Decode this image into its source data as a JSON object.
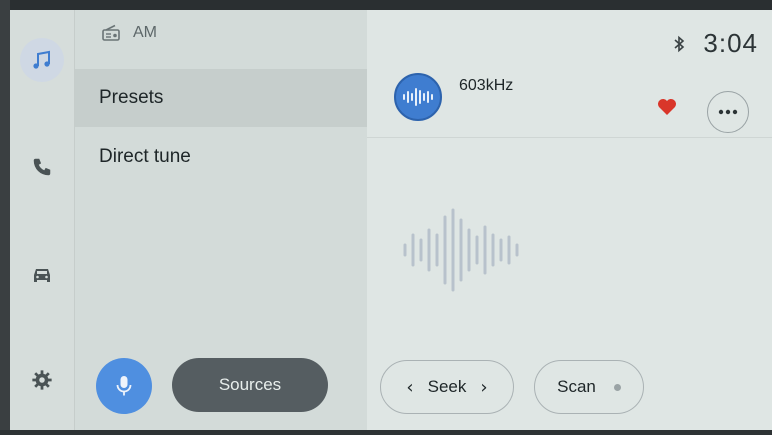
{
  "band": {
    "label": "AM"
  },
  "menu": {
    "items": [
      {
        "label": "Presets",
        "selected": true
      },
      {
        "label": "Direct tune",
        "selected": false
      }
    ]
  },
  "sources_label": "Sources",
  "status": {
    "time": "3:04",
    "bluetooth_icon": "bluetooth-icon"
  },
  "now_playing": {
    "frequency": "603kHz",
    "favorited": true
  },
  "controls": {
    "seek_label": "Seek",
    "scan_label": "Scan"
  },
  "nav_rail": [
    {
      "icon": "music-note-icon",
      "active": true
    },
    {
      "icon": "phone-icon",
      "active": false
    },
    {
      "icon": "car-icon",
      "active": false
    },
    {
      "icon": "gear-icon",
      "active": false
    }
  ],
  "colors": {
    "accent": "#4f8fe0",
    "favorite": "#d9362a",
    "dark_button": "#555d61"
  }
}
